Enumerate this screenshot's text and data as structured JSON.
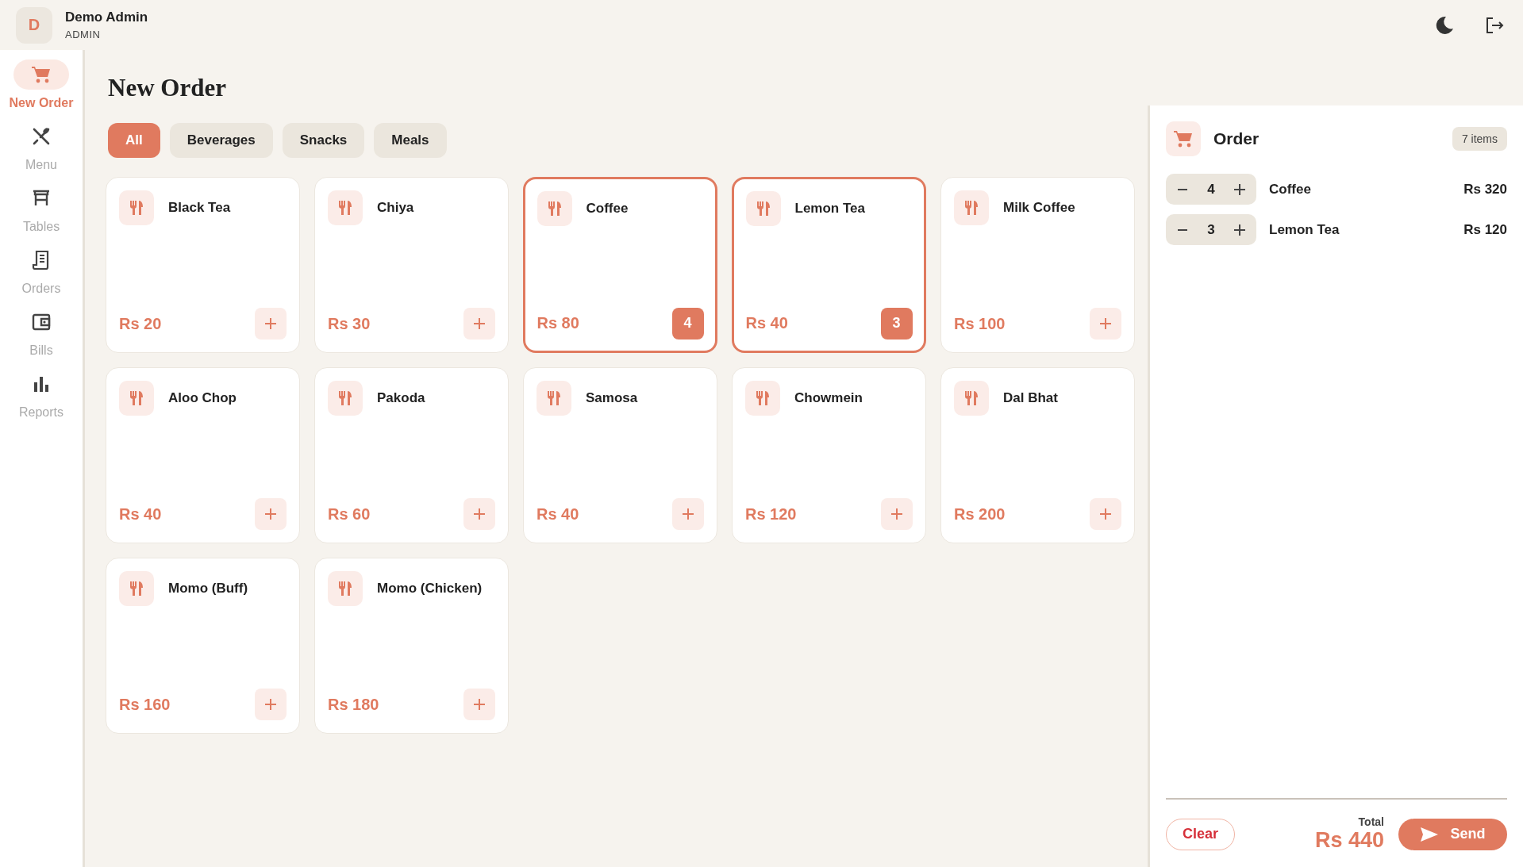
{
  "user": {
    "initial": "D",
    "name": "Demo Admin",
    "role": "ADMIN"
  },
  "nav": [
    {
      "label": "New Order",
      "selected": true
    },
    {
      "label": "Menu",
      "selected": false
    },
    {
      "label": "Tables",
      "selected": false
    },
    {
      "label": "Orders",
      "selected": false
    },
    {
      "label": "Bills",
      "selected": false
    },
    {
      "label": "Reports",
      "selected": false
    }
  ],
  "page_title": "New Order",
  "categories": [
    {
      "label": "All",
      "selected": true
    },
    {
      "label": "Beverages",
      "selected": false
    },
    {
      "label": "Snacks",
      "selected": false
    },
    {
      "label": "Meals",
      "selected": false
    }
  ],
  "products": [
    {
      "name": "Black Tea",
      "price": "Rs 20",
      "selected": false
    },
    {
      "name": "Chiya",
      "price": "Rs 30",
      "selected": false
    },
    {
      "name": "Coffee",
      "price": "Rs 80",
      "selected": true,
      "quantity": "4"
    },
    {
      "name": "Lemon Tea",
      "price": "Rs 40",
      "selected": true,
      "quantity": "3"
    },
    {
      "name": "Milk Coffee",
      "price": "Rs 100",
      "selected": false
    },
    {
      "name": "Aloo Chop",
      "price": "Rs 40",
      "selected": false
    },
    {
      "name": "Pakoda",
      "price": "Rs 60",
      "selected": false
    },
    {
      "name": "Samosa",
      "price": "Rs 40",
      "selected": false
    },
    {
      "name": "Chowmein",
      "price": "Rs 120",
      "selected": false
    },
    {
      "name": "Dal Bhat",
      "price": "Rs 200",
      "selected": false
    },
    {
      "name": "Momo (Buff)",
      "price": "Rs 160",
      "selected": false
    },
    {
      "name": "Momo (Chicken)",
      "price": "Rs 180",
      "selected": false
    }
  ],
  "order": {
    "title": "Order",
    "count": "7 items",
    "items": [
      {
        "quantity": "4",
        "name": "Coffee",
        "amount": "Rs 320"
      },
      {
        "quantity": "3",
        "name": "Lemon Tea",
        "amount": "Rs 120"
      }
    ],
    "clear": "Clear",
    "total_label": "Total",
    "total": "Rs 440",
    "send": "Send"
  }
}
